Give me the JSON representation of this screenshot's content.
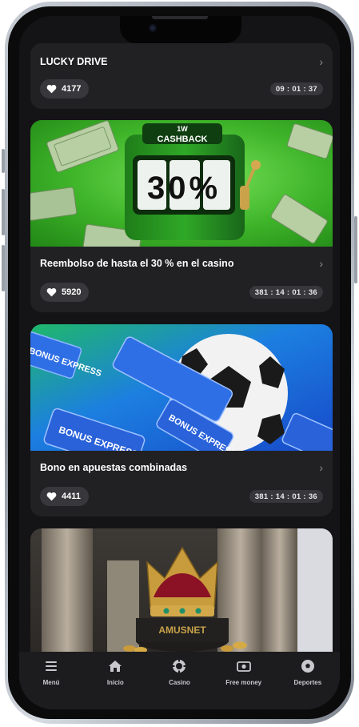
{
  "cards": [
    {
      "title": "LUCKY DRIVE",
      "likes": "4177",
      "timer": "09 : 01 : 37"
    },
    {
      "title": "Reembolso de hasta el 30 % en el casino",
      "likes": "5920",
      "timer": "381 : 14 : 01 : 36",
      "banner": {
        "brand": "1W",
        "label": "CASHBACK",
        "percent": "30%"
      }
    },
    {
      "title": "Bono en apuestas combinadas",
      "likes": "4411",
      "timer": "381 : 14 : 01 : 36",
      "banner": {
        "ticket_text": "BONUS EXPRESS"
      }
    },
    {
      "banner": {
        "brand": "AMUSNET"
      }
    }
  ],
  "nav": {
    "menu": "Menú",
    "home": "Inicio",
    "casino": "Casino",
    "free_money": "Free money",
    "sports": "Deportes"
  },
  "colors": {
    "screen_bg": "#141416",
    "card_bg": "#212124",
    "pill_bg": "#38383c",
    "cashback_green": "#3fb52a",
    "express_blue": "#1f63d8"
  }
}
